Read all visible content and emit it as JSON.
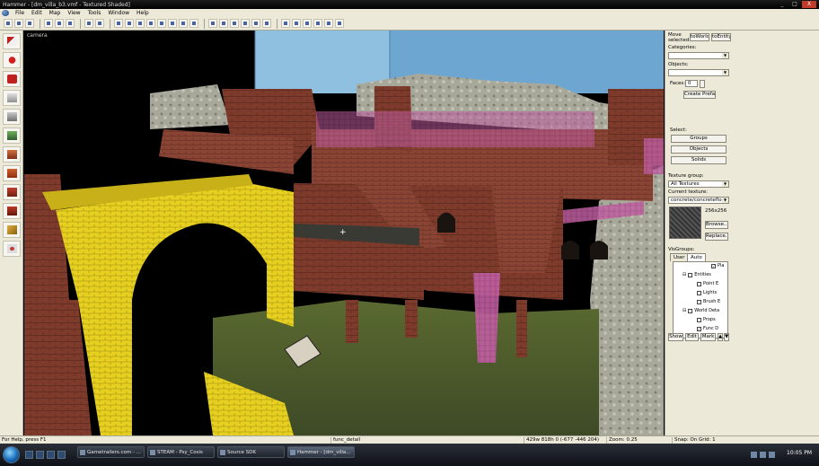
{
  "window": {
    "title": "Hammer - [dm_villa_b3.vmf - Textured Shaded]",
    "controls": [
      "_",
      "□",
      "X"
    ]
  },
  "menu": [
    "File",
    "Edit",
    "Map",
    "View",
    "Tools",
    "Window",
    "Help"
  ],
  "viewport": {
    "label": "camera",
    "crosshair": "+"
  },
  "panel": {
    "move_selected": {
      "label": "Move selected:",
      "to_world": "toWorld",
      "to_entity": "toEntity"
    },
    "categories_label": "Categories:",
    "objects_label": "Objects:",
    "faces_label": "Faces:",
    "faces_value": "0",
    "create_prefab": "Create Prefab",
    "select_label": "Select:",
    "groups_button": "Groups",
    "objects_button": "Objects",
    "solids_button": "Solids",
    "texture_group_label": "Texture group:",
    "texture_group_value": "All Textures",
    "current_texture_label": "Current texture:",
    "current_texture_value": "concrete/concretefloor",
    "texture_size": "256x256",
    "browse_button": "Browse...",
    "replace_button": "Replace...",
    "visgroups_label": "VisGroups:",
    "tabs": [
      "User",
      "Auto"
    ],
    "tree": [
      {
        "label": "Pla",
        "checked": true,
        "indent": 4,
        "expander": false
      },
      {
        "label": "Entities",
        "checked": false,
        "indent": 1,
        "expander": true
      },
      {
        "label": "Point E",
        "checked": false,
        "indent": 2,
        "expander": false
      },
      {
        "label": "Lights",
        "checked": false,
        "indent": 2,
        "expander": false
      },
      {
        "label": "Brush E",
        "checked": false,
        "indent": 2,
        "expander": false
      },
      {
        "label": "World Deta",
        "checked": false,
        "indent": 1,
        "expander": true
      },
      {
        "label": "Props",
        "checked": false,
        "indent": 2,
        "expander": false
      },
      {
        "label": "Func D",
        "checked": true,
        "indent": 2,
        "expander": false
      }
    ],
    "show_button": "Show",
    "edit_button": "Edit",
    "mark_button": "Mark"
  },
  "status": {
    "help": "For Help, press F1",
    "object": "func_detail",
    "size": "429w 818h 0 (-677 -446 204)",
    "zoom": "Zoom: 0.25",
    "snap": "Snap: On Grid: 1"
  },
  "taskbar": {
    "tasks": [
      "Gametrailers.com - ...",
      "STEAM - Psy_Cosis",
      "Source SDK",
      "Hammer - [dm_villa..."
    ],
    "time": "10:05 PM"
  },
  "colors": {
    "chrome": "#ece9d8",
    "yellow_brush": "#e8d020",
    "brick": "#7e3b2c",
    "grass": "#4d5d2c",
    "sky": "#7ab0d8"
  }
}
